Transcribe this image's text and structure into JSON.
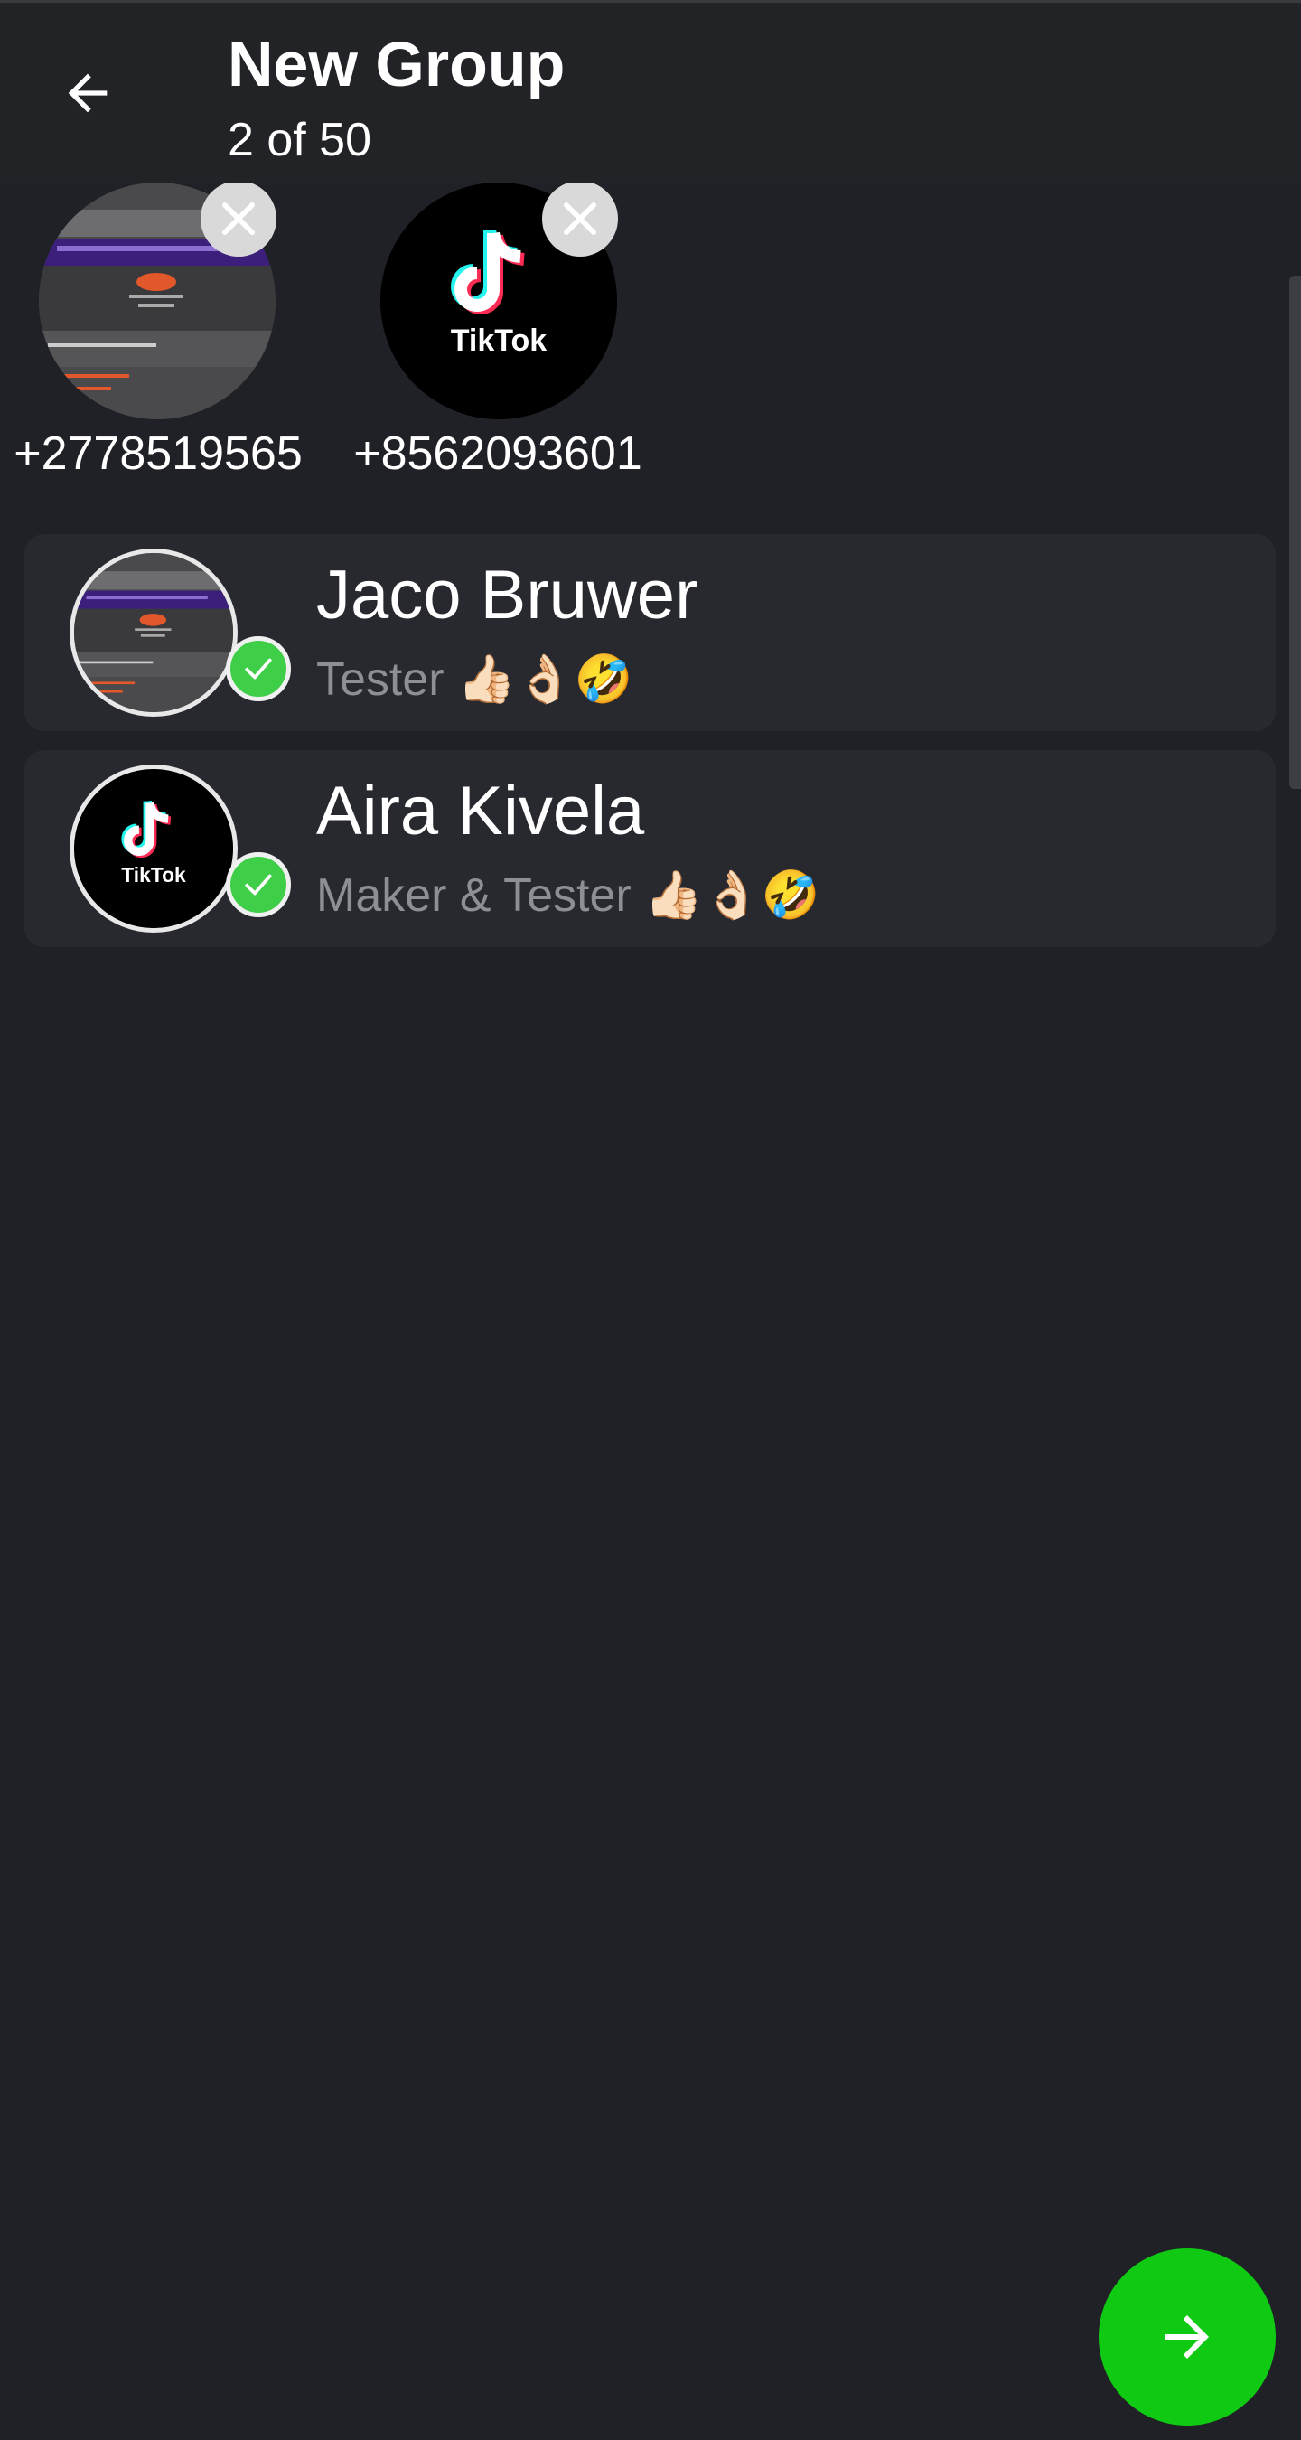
{
  "header": {
    "title": "New Group",
    "subtitle": "2 of 50"
  },
  "selected_chips": [
    {
      "label": "+2778519565",
      "label_overflow": "1",
      "avatar": "screenshot-thumbnail"
    },
    {
      "label": "+8562093601",
      "label_overflow": "001",
      "avatar": "tiktok-logo"
    }
  ],
  "contacts": [
    {
      "name": "Jaco Bruwer",
      "status": "Tester 👍🏻👌🏻🤣",
      "selected": true,
      "avatar": "screenshot-thumbnail"
    },
    {
      "name": "Aira Kivela",
      "status": "Maker & Tester 👍🏻👌🏻🤣",
      "selected": true,
      "avatar": "tiktok-logo"
    }
  ],
  "tiktok_text": "TikTok",
  "icons": {
    "back": "arrow-left-icon",
    "remove": "close-icon",
    "check": "check-icon",
    "next": "arrow-right-icon"
  },
  "colors": {
    "background": "#1f2126",
    "topbar": "#222326",
    "row": "#27292f",
    "accent_green": "#10c913",
    "check_green": "#3fce48",
    "status_gray": "#8e8f93"
  }
}
